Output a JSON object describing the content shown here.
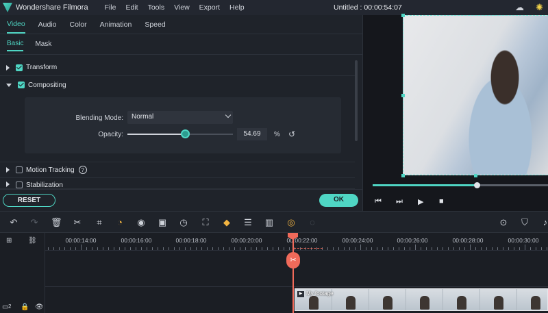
{
  "app": {
    "name": "Wondershare Filmora",
    "menu": [
      "File",
      "Edit",
      "Tools",
      "View",
      "Export",
      "Help"
    ],
    "title": "Untitled : 00:00:54:07"
  },
  "panel": {
    "tabs": [
      {
        "label": "Video",
        "active": true
      },
      {
        "label": "Audio",
        "active": false
      },
      {
        "label": "Color",
        "active": false
      },
      {
        "label": "Animation",
        "active": false
      },
      {
        "label": "Speed",
        "active": false
      }
    ],
    "subtabs": [
      {
        "label": "Basic",
        "active": true
      },
      {
        "label": "Mask",
        "active": false
      }
    ],
    "sections": {
      "transform": {
        "label": "Transform",
        "checked": true,
        "expanded": false
      },
      "compositing": {
        "label": "Compositing",
        "checked": true,
        "expanded": true
      },
      "motion_tracking": {
        "label": "Motion Tracking",
        "checked": false,
        "expanded": false
      },
      "stabilization": {
        "label": "Stabilization",
        "checked": false,
        "expanded": false
      }
    },
    "blending_mode": {
      "label": "Blending Mode:",
      "value": "Normal"
    },
    "opacity": {
      "label": "Opacity:",
      "value": "54.69",
      "unit": "%",
      "level": 0.5469
    },
    "reset_label": "RESET",
    "ok_label": "OK"
  },
  "preview": {
    "progress": 0.59
  },
  "timeline": {
    "ticks": [
      "00:00:14:00",
      "00:00:16:00",
      "00:00:18:00",
      "00:00:20:00",
      "00:00:22:00",
      "00:00:24:00",
      "00:00:26:00",
      "00:00:28:00",
      "00:00:30:00"
    ],
    "clip_label": "My footage",
    "track_number": "2"
  },
  "colors": {
    "accent": "#4fd6c4",
    "playhead": "#f06a5a",
    "background": "#1b1e24"
  }
}
